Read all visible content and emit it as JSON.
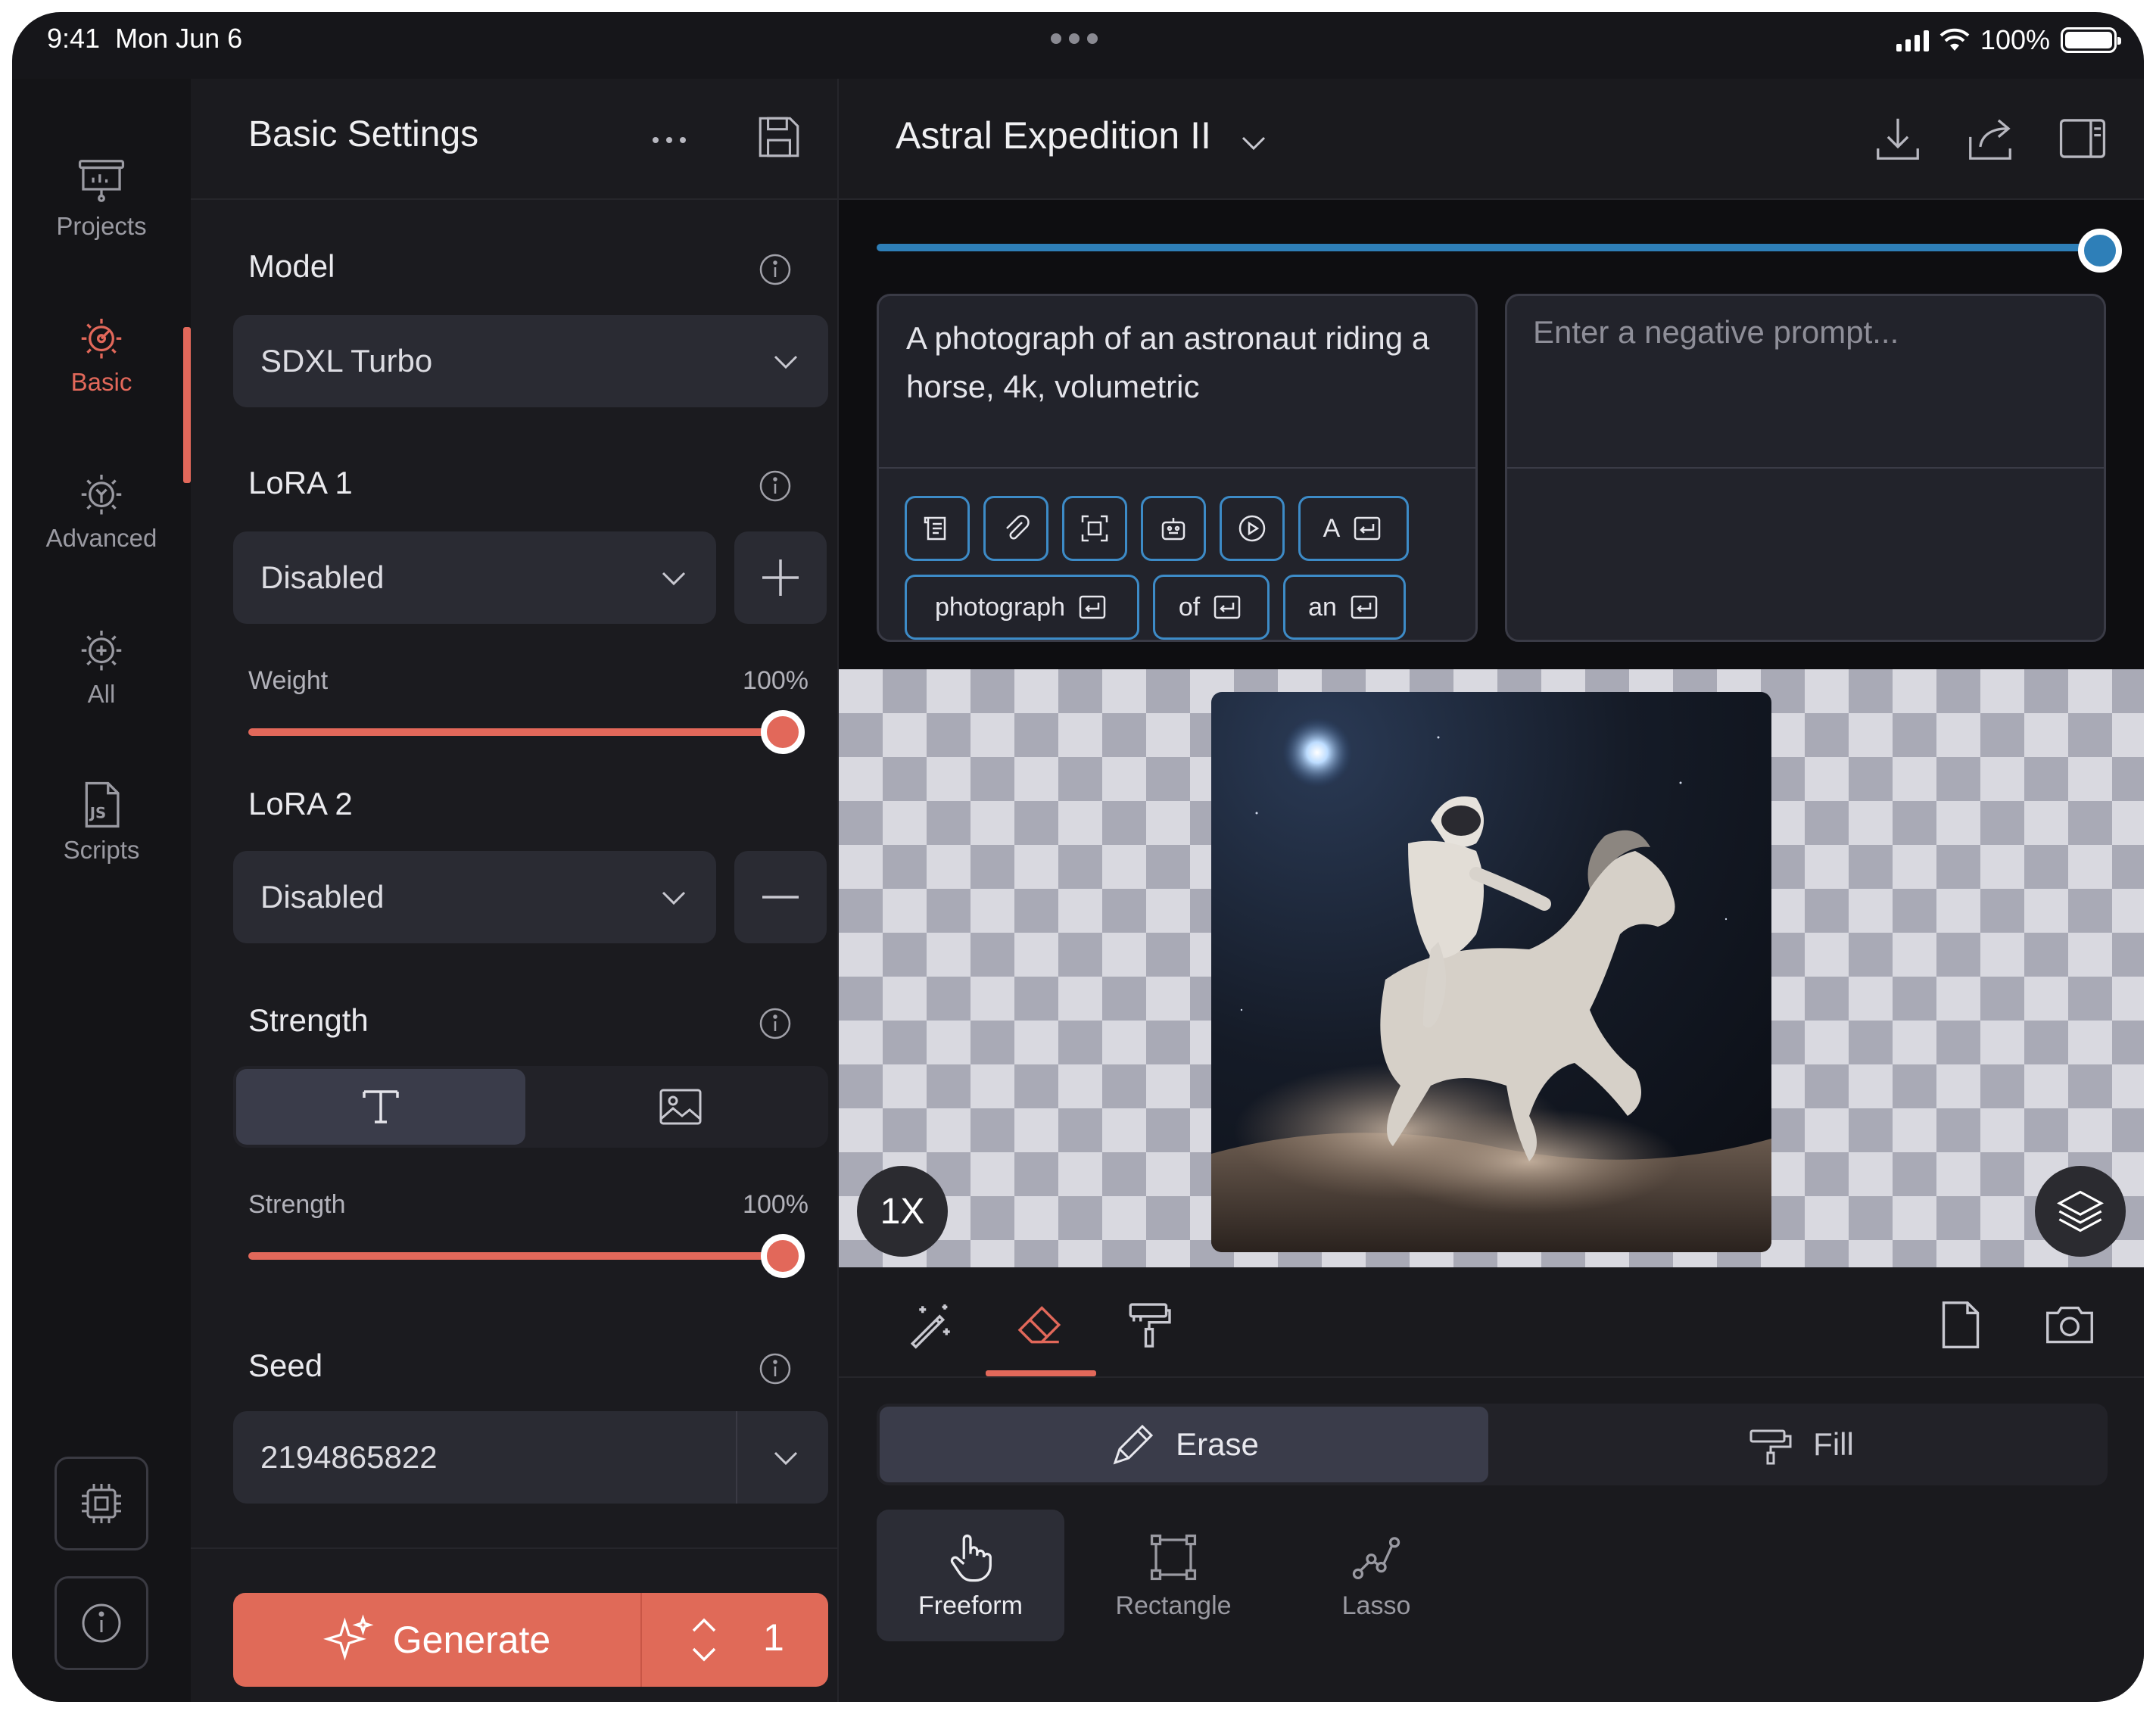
{
  "status": {
    "time": "9:41",
    "date": "Mon Jun 6",
    "battery": "100%"
  },
  "rail": {
    "items": [
      {
        "label": "Projects"
      },
      {
        "label": "Basic",
        "active": true
      },
      {
        "label": "Advanced"
      },
      {
        "label": "All"
      },
      {
        "label": "Scripts"
      }
    ]
  },
  "settings": {
    "title": "Basic Settings",
    "model": {
      "label": "Model",
      "value": "SDXL Turbo"
    },
    "lora1": {
      "label": "LoRA 1",
      "value": "Disabled",
      "weight_label": "Weight",
      "weight_value": "100%",
      "weight_fraction": 1.0
    },
    "lora2": {
      "label": "LoRA 2",
      "value": "Disabled"
    },
    "strength": {
      "label": "Strength",
      "slider_label": "Strength",
      "slider_value": "100%",
      "fraction": 1.0,
      "modes": [
        "text-icon",
        "image-icon"
      ],
      "selected_mode": "text-icon"
    },
    "seed": {
      "label": "Seed",
      "value": "2194865822"
    },
    "generate": {
      "label": "Generate",
      "count": "1"
    }
  },
  "main": {
    "project_title": "Astral Expedition II",
    "steps_fraction": 1.0,
    "prompt": "A photograph of an astronaut riding a horse, 4k, volumetric",
    "negative_placeholder": "Enter a negative prompt...",
    "prompt_tools": [
      "scroll-icon",
      "paperclip-icon",
      "focus-icon",
      "robot-icon",
      "play-icon"
    ],
    "token_chips": [
      {
        "label": "A"
      },
      {
        "label": "photograph"
      },
      {
        "label": "of"
      },
      {
        "label": "an"
      }
    ],
    "zoom": "1X",
    "erase_label": "Erase",
    "fill_label": "Fill",
    "shapes": [
      {
        "label": "Freeform",
        "selected": true
      },
      {
        "label": "Rectangle"
      },
      {
        "label": "Lasso"
      }
    ]
  },
  "colors": {
    "accent": "#e2685a",
    "steps_accent": "#2e7fb8",
    "panel": "#1b1b1f",
    "chip_border": "#3d8bc7"
  }
}
